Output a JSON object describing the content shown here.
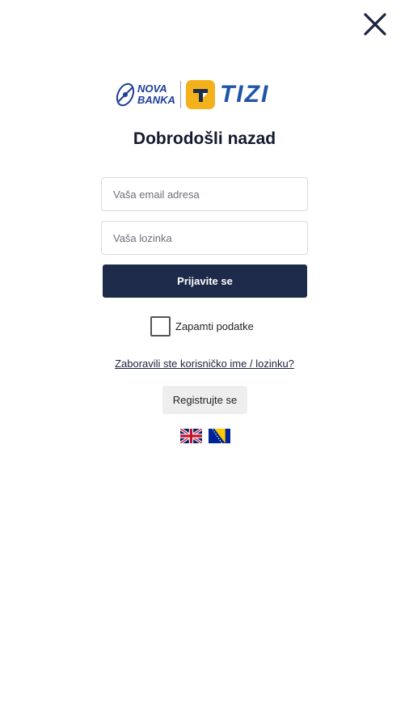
{
  "header": {
    "close_icon": "close-icon"
  },
  "brand": {
    "nova_line1": "NOVA",
    "nova_line2": "BANKA",
    "tizi": "TIZI",
    "colors": {
      "nova_blue": "#1f3d99",
      "tizi_yellow": "#f3b21b",
      "tizi_blue": "#1f55a8"
    }
  },
  "login": {
    "title": "Dobrodošli nazad",
    "email_placeholder": "Vaša email adresa",
    "password_placeholder": "Vaša lozinka",
    "submit_label": "Prijavite se",
    "remember_label": "Zapamti podatke",
    "remember_checked": false,
    "forgot_label": "Zaboravili ste korisničko ime / lozinku?",
    "register_label": "Registrujte se",
    "primary_color": "#1e2a4a"
  },
  "languages": [
    {
      "icon": "uk-flag-icon"
    },
    {
      "icon": "bosnia-flag-icon"
    }
  ]
}
